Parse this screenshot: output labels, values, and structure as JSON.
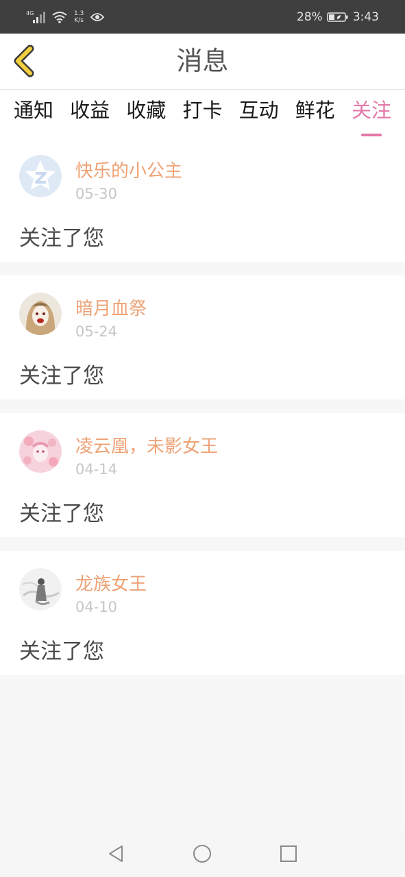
{
  "status_bar": {
    "network": "4G",
    "speed_value": "1.3",
    "speed_unit": "K/s",
    "battery": "28%",
    "time": "3:43"
  },
  "header": {
    "title": "消息",
    "back_icon": "chevron-left-icon"
  },
  "tabs": [
    {
      "label": "通知",
      "active": false
    },
    {
      "label": "收益",
      "active": false
    },
    {
      "label": "收藏",
      "active": false
    },
    {
      "label": "打卡",
      "active": false
    },
    {
      "label": "互动",
      "active": false
    },
    {
      "label": "鲜花",
      "active": false
    },
    {
      "label": "关注",
      "active": true
    }
  ],
  "messages": [
    {
      "user": "快乐的小公主",
      "date": "05-30",
      "text": "关注了您"
    },
    {
      "user": "暗月血祭",
      "date": "05-24",
      "text": "关注了您"
    },
    {
      "user": "凌云凰，未影女王",
      "date": "04-14",
      "text": "关注了您"
    },
    {
      "user": "龙族女王",
      "date": "04-10",
      "text": "关注了您"
    }
  ],
  "colors": {
    "accent": "#e577a8",
    "username": "#eea275",
    "date": "#c6c6c6",
    "back_icon": "#f2cf3f"
  }
}
